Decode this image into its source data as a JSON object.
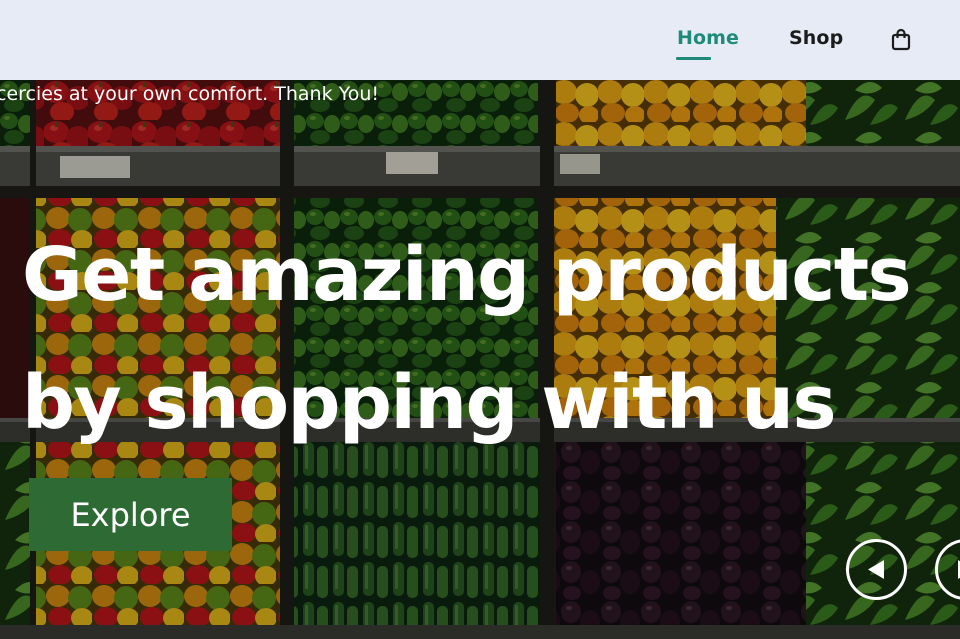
{
  "nav": {
    "home_label": "Home",
    "shop_label": "Shop",
    "cart_icon": "shopping-bag-icon",
    "active": "Home",
    "active_color": "#1f8a7a"
  },
  "hero": {
    "marquee_text": "cercies at your own comfort. Thank You!",
    "headline_line1": "Get amazing products",
    "headline_line2": "by shopping with us",
    "cta_label": "Explore",
    "cta_color": "#2e6b34",
    "prev_icon": "chevron-left-icon",
    "next_icon": "chevron-right-icon",
    "background_image": "produce-display-photo"
  }
}
